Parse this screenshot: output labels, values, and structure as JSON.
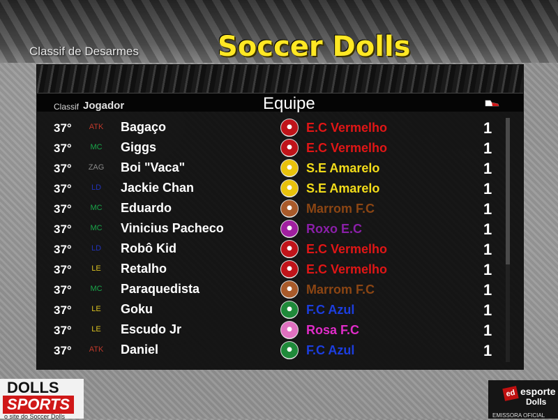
{
  "screen": {
    "section_label": "Classif de Desarmes",
    "game_title": "Soccer Dolls"
  },
  "table": {
    "headers": {
      "rank": "Classif",
      "player": "Jogador",
      "team": "Equipe",
      "tackles_icon": "boot-icon"
    },
    "rows": [
      {
        "rank": "37°",
        "pos": "ATK",
        "name": "Bagaço",
        "team": "E.C Vermelho",
        "crest": "red-crest-icon",
        "tackles": "1"
      },
      {
        "rank": "37°",
        "pos": "MC",
        "name": "Giggs",
        "team": "E.C Vermelho",
        "crest": "red-crest-icon",
        "tackles": "1"
      },
      {
        "rank": "37°",
        "pos": "ZAG",
        "name": "Boi \"Vaca\"",
        "team": "S.E Amarelo",
        "crest": "yellow-crest-icon",
        "tackles": "1"
      },
      {
        "rank": "37°",
        "pos": "LD",
        "name": "Jackie Chan",
        "team": "S.E Amarelo",
        "crest": "yellow-crest-icon",
        "tackles": "1"
      },
      {
        "rank": "37°",
        "pos": "MC",
        "name": "Eduardo",
        "team": "Marrom F.C",
        "crest": "brown-crest-icon",
        "tackles": "1"
      },
      {
        "rank": "37°",
        "pos": "MC",
        "name": "Vinicius Pacheco",
        "team": "Roxo E.C",
        "crest": "purple-crest-icon",
        "tackles": "1"
      },
      {
        "rank": "37°",
        "pos": "LD",
        "name": "Robô Kid",
        "team": "E.C Vermelho",
        "crest": "red-crest-icon",
        "tackles": "1"
      },
      {
        "rank": "37°",
        "pos": "LE",
        "name": "Retalho",
        "team": "E.C Vermelho",
        "crest": "red-crest-icon",
        "tackles": "1"
      },
      {
        "rank": "37°",
        "pos": "MC",
        "name": "Paraquedista",
        "team": "Marrom F.C",
        "crest": "brown-crest-icon",
        "tackles": "1"
      },
      {
        "rank": "37°",
        "pos": "LE",
        "name": "Goku",
        "team": "F.C Azul",
        "crest": "blue-crest-icon",
        "tackles": "1"
      },
      {
        "rank": "37°",
        "pos": "LE",
        "name": "Escudo Jr",
        "team": "Rosa F.C",
        "crest": "pink-crest-icon",
        "tackles": "1"
      },
      {
        "rank": "37°",
        "pos": "ATK",
        "name": "Daniel",
        "team": "F.C Azul",
        "crest": "blue-crest-icon",
        "tackles": "1"
      }
    ]
  },
  "colors": {
    "title_yellow": "#ffe824",
    "pos": {
      "ATK": "#c0392b",
      "MC": "#1aa64a",
      "ZAG": "#8a8a8a",
      "LD": "#2233bb",
      "LE": "#d9c020"
    },
    "team": {
      "E.C Vermelho": "#e01616",
      "S.E Amarelo": "#f2dc1a",
      "Marrom F.C": "#8b4513",
      "Roxo E.C": "#8a1fa8",
      "F.C Azul": "#1c3ee0",
      "Rosa F.C": "#e02cc8"
    },
    "crest": {
      "E.C Vermelho": "#c0141a",
      "S.E Amarelo": "#e8c20c",
      "Marrom F.C": "#a85a2a",
      "Roxo E.C": "#a01fa0",
      "F.C Azul": "#1f8a3a",
      "Rosa F.C": "#e070c0"
    }
  },
  "footer": {
    "left_logo_line1": "DOLLS",
    "left_logo_line2": "SPORTS",
    "left_tagline": "o site do Soccer Dolls",
    "right_badge": "ed",
    "right_brand1": "esporte",
    "right_brand2": "Dolls",
    "right_sub": "EMISSORA OFICIAL"
  }
}
